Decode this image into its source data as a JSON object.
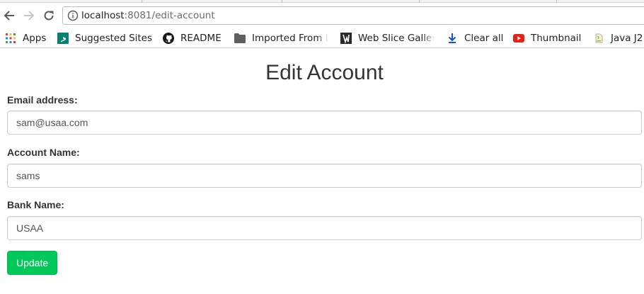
{
  "browser": {
    "url_host": "localhost",
    "url_rest": ":8081/edit-account"
  },
  "bookmarks": [
    {
      "label": "Apps",
      "icon": "apps-grid-icon"
    },
    {
      "label": "Suggested Sites",
      "icon": "bing-icon"
    },
    {
      "label": "README",
      "icon": "github-icon"
    },
    {
      "label": "Imported From I",
      "icon": "folder-icon"
    },
    {
      "label": "Web Slice Galler",
      "icon": "web-slice-icon"
    },
    {
      "label": "Clear all",
      "icon": "download-icon"
    },
    {
      "label": "Thumbnail",
      "icon": "youtube-icon"
    },
    {
      "label": "Java J2",
      "icon": "java-icon"
    }
  ],
  "form": {
    "title": "Edit Account",
    "email_label": "Email address:",
    "email_value": "sam@usaa.com",
    "account_label": "Account Name:",
    "account_value": "sams",
    "bank_label": "Bank Name:",
    "bank_value": "USAA",
    "submit_label": "Update"
  },
  "colors": {
    "button": "#00c95a",
    "youtube": "#e62117",
    "bing": "#008373"
  }
}
